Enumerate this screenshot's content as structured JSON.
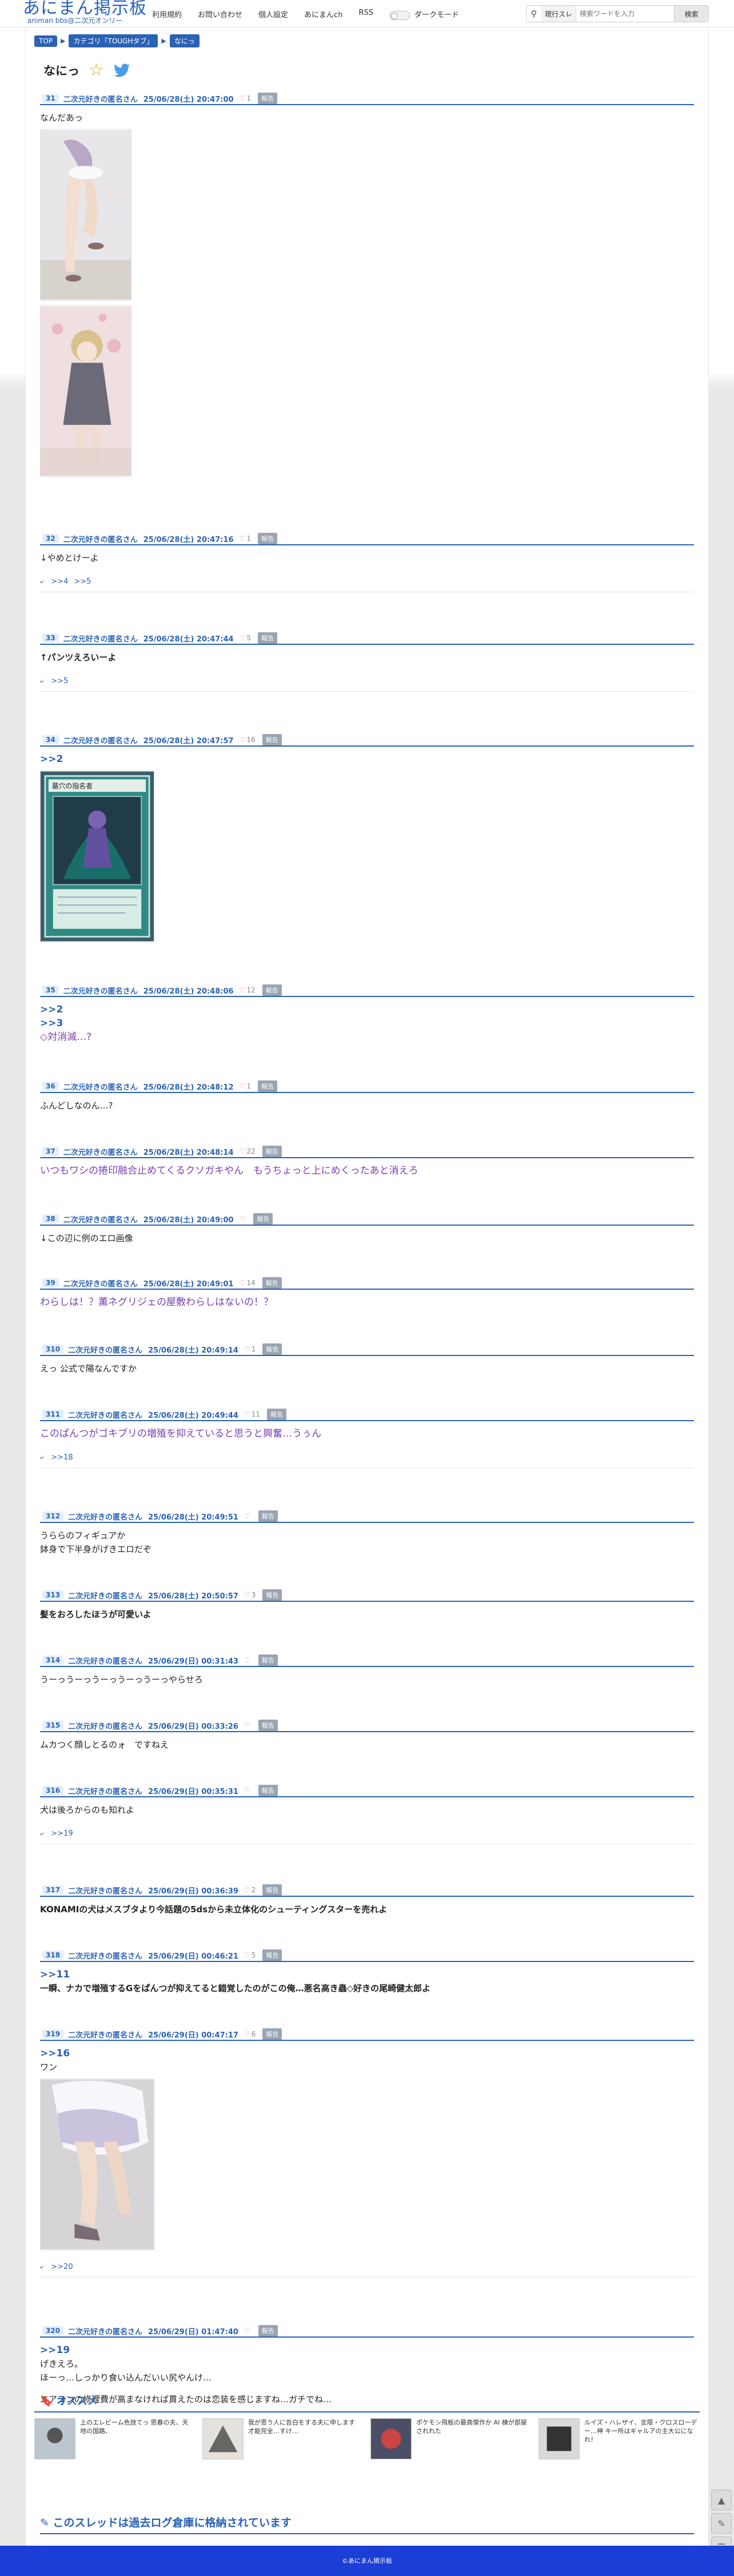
{
  "header": {
    "logo_main": "あにまん掲示板",
    "logo_sub": "animan bbs@二次元オンリー",
    "nav": [
      "利用規約",
      "お問い合わせ",
      "個人設定",
      "あにまんch",
      "RSS"
    ],
    "dark_mode": "ダークモード",
    "search_scope": "現行スレ",
    "search_placeholder": "検索ワードを入力",
    "search_button": "検索"
  },
  "breadcrumb": [
    "TOP",
    "カテゴリ「TOUGHタブ」",
    "なにっ"
  ],
  "thread_title": "なにっ",
  "posts": [
    {
      "num": "31",
      "name": "二次元好きの匿名さん",
      "date": "25/06/28(土) 20:47:00",
      "likes": "1",
      "report": "報告",
      "body": [
        "なんだあっ"
      ]
    },
    {
      "num": "32",
      "name": "二次元好きの匿名さん",
      "date": "25/06/28(土) 20:47:16",
      "likes": "1",
      "report": "報告",
      "body": [
        "↓やめとけーよ"
      ],
      "replies": [
        ">>4",
        ">>5"
      ]
    },
    {
      "num": "33",
      "name": "二次元好きの匿名さん",
      "date": "25/06/28(土) 20:47:44",
      "likes": "5",
      "report": "報告",
      "body": [
        "↑パンツえろいーよ"
      ],
      "replies": [
        ">>5"
      ]
    },
    {
      "num": "34",
      "name": "二次元好きの匿名さん",
      "date": "25/06/28(土) 20:47:57",
      "likes": "16",
      "report": "報告",
      "anchor": ">>2"
    },
    {
      "num": "35",
      "name": "二次元好きの匿名さん",
      "date": "25/06/28(土) 20:48:06",
      "likes": "12",
      "report": "報告",
      "anchors": [
        ">>2",
        ">>3"
      ],
      "body": [
        "◇対消滅…?"
      ]
    },
    {
      "num": "36",
      "name": "二次元好きの匿名さん",
      "date": "25/06/28(土) 20:48:12",
      "likes": "1",
      "report": "報告",
      "body": [
        "ふんどしなのん…?"
      ]
    },
    {
      "num": "37",
      "name": "二次元好きの匿名さん",
      "date": "25/06/28(土) 20:48:14",
      "likes": "22",
      "report": "報告",
      "body": [
        "いつもワシの捲印融合止めてくるクソガキやん　もうちょっと上にめくったあと消えろ"
      ]
    },
    {
      "num": "38",
      "name": "二次元好きの匿名さん",
      "date": "25/06/28(土) 20:49:00",
      "likes": "",
      "report": "報告",
      "body": [
        "↓この辺に例のエロ画像"
      ]
    },
    {
      "num": "39",
      "name": "二次元好きの匿名さん",
      "date": "25/06/28(土) 20:49:01",
      "likes": "14",
      "report": "報告",
      "body": [
        "わらしは！？薫ネグリジェの屋敷わらしはないの！？"
      ]
    },
    {
      "num": "310",
      "name": "二次元好きの匿名さん",
      "date": "25/06/28(土) 20:49:14",
      "likes": "1",
      "report": "報告",
      "body": [
        "えっ 公式で陽なんですか"
      ]
    },
    {
      "num": "311",
      "name": "二次元好きの匿名さん",
      "date": "25/06/28(土) 20:49:44",
      "likes": "11",
      "report": "報告",
      "body": [
        "このぱんつがゴキブリの増殖を抑えていると思うと興奮…うぅん"
      ],
      "replies": [
        ">>18"
      ]
    },
    {
      "num": "312",
      "name": "二次元好きの匿名さん",
      "date": "25/06/28(土) 20:49:51",
      "likes": "",
      "report": "報告",
      "body": [
        "うららのフィギュアか",
        "鉢身で下半身がげきエロだぞ"
      ]
    },
    {
      "num": "313",
      "name": "二次元好きの匿名さん",
      "date": "25/06/28(土) 20:50:57",
      "likes": "3",
      "report": "報告",
      "body": [
        "髪をおろしたほうが可愛いよ"
      ]
    },
    {
      "num": "314",
      "name": "二次元好きの匿名さん",
      "date": "25/06/29(日) 00:31:43",
      "likes": "",
      "report": "報告",
      "body": [
        "うーっうーっうーっうーっうーっやらせろ"
      ]
    },
    {
      "num": "315",
      "name": "二次元好きの匿名さん",
      "date": "25/06/29(日) 00:33:26",
      "likes": "",
      "report": "報告",
      "body": [
        "ムカつく顔しとるのォ　ですねえ"
      ]
    },
    {
      "num": "316",
      "name": "二次元好きの匿名さん",
      "date": "25/06/29(日) 00:35:31",
      "likes": "",
      "report": "報告",
      "body": [
        "犬は後ろからのも知れよ"
      ],
      "replies": [
        ">>19"
      ]
    },
    {
      "num": "317",
      "name": "二次元好きの匿名さん",
      "date": "25/06/29(日) 00:36:39",
      "likes": "2",
      "report": "報告",
      "body": [
        "KONAMIの犬はメスブタより今話題の5dsから未立体化のシューティングスターを売れよ"
      ]
    },
    {
      "num": "318",
      "name": "二次元好きの匿名さん",
      "date": "25/06/29(日) 00:46:21",
      "likes": "5",
      "report": "報告",
      "anchor": ">>11",
      "body": [
        "一瞬、ナカで増殖するGをぱんつが抑えてると錯覚したのがこの俺…悪名高き蟲◇好きの尾崎健太郎よ"
      ]
    },
    {
      "num": "319",
      "name": "二次元好きの匿名さん",
      "date": "25/06/29(日) 00:47:17",
      "likes": "6",
      "report": "報告",
      "anchor": ">>16",
      "body": [
        "ワン"
      ],
      "replies": [
        ">>20"
      ]
    },
    {
      "num": "320",
      "name": "二次元好きの匿名さん",
      "date": "25/06/29(日) 01:47:40",
      "likes": "",
      "report": "報告",
      "anchor": ">>19",
      "body": [
        "げきえろ。",
        "ほーっ…しっかり食い込んだいい尻やんけ…",
        "",
        "エアコンの修理費が高まなければ貫えたのは恋装を感じますね…ガチでね…"
      ]
    }
  ],
  "card_text": "墓穴の指名者",
  "osusume": {
    "heading": "オススメ",
    "items": [
      "上のエレビーム色放てっ 思春の夫、天地の国路、",
      "我が思う人に告白をする夫に申します 才能完全…すけ…",
      "ポケモン飛板の最高傑作か AI 棟が部屋されれた",
      "ルイズ・ハレザイ、言限・クロスローデー…神 キー所はギャルアの主大公になれ！"
    ]
  },
  "archived": "このスレッドは過去ログ倉庫に格納されています",
  "footer": "©あにまん掲示板"
}
